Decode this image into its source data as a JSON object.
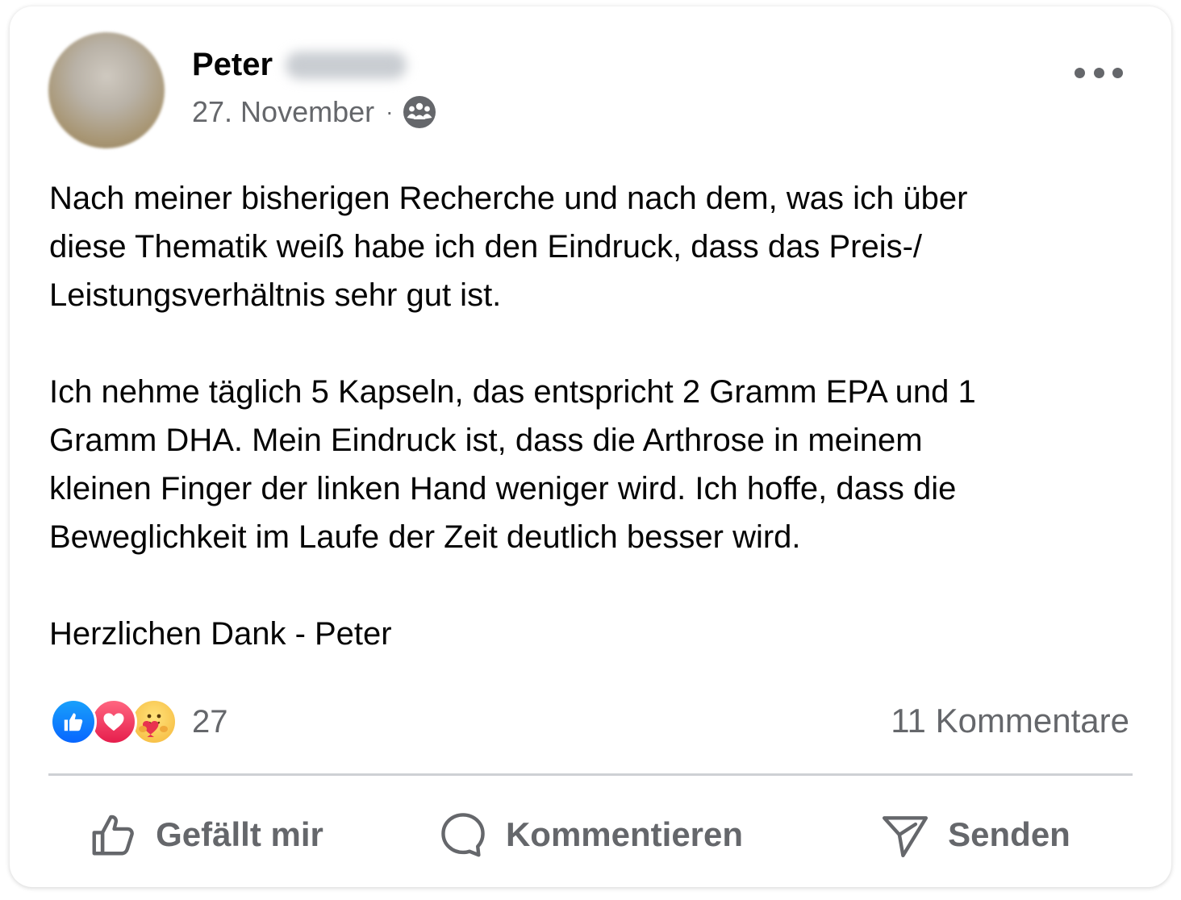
{
  "post": {
    "author_first_name": "Peter",
    "date": "27. November",
    "separator": "·",
    "audience_icon": "group-icon",
    "menu_icon": "more-options-icon",
    "paragraphs": [
      "Nach meiner bisherigen Recherche und nach dem, was ich über\ndiese Thematik weiß habe ich den Eindruck, dass das Preis-/\nLeistungsverhältnis sehr gut ist.",
      "Ich nehme täglich 5 Kapseln, das entspricht 2 Gramm EPA und 1\nGramm DHA. Mein Eindruck ist, dass die Arthrose in meinem\nkleinen Finger der linken Hand weniger wird. Ich hoffe, dass die\nBeweglichkeit im Laufe der Zeit deutlich besser wird.",
      "Herzlichen Dank - Peter"
    ]
  },
  "reactions": {
    "types": [
      "like-reaction-icon",
      "love-reaction-icon",
      "care-reaction-icon"
    ],
    "count": "27",
    "comments_label": "11 Kommentare"
  },
  "actions": {
    "like_label": "Gefällt mir",
    "comment_label": "Kommentieren",
    "send_label": "Senden"
  },
  "colors": {
    "text_primary": "#050505",
    "text_secondary": "#65676b",
    "like_blue": "#0866ff",
    "love_red": "#e61e4d",
    "divider": "#ced0d4"
  }
}
